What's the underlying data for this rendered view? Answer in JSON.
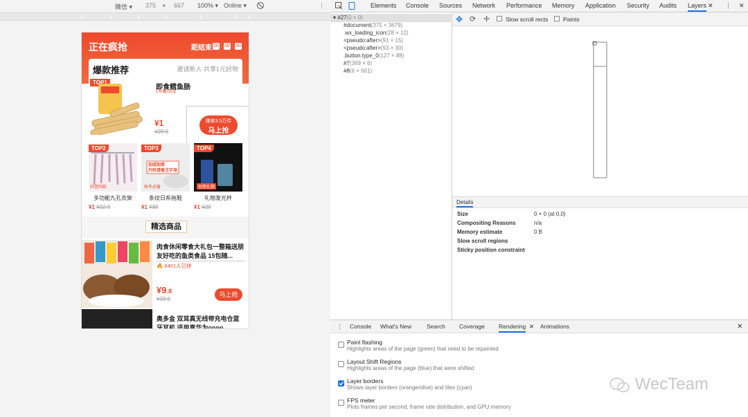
{
  "device_toolbar": {
    "device": "微信 ▾",
    "width": "375",
    "height": "667",
    "zoom": "100% ▾",
    "network": "Online ▾",
    "times": "×"
  },
  "phone": {
    "header_title": "正在疯抢",
    "countdown_label": "距结束",
    "countdown": [
      "00",
      "00",
      "00"
    ],
    "card_title": "爆款推荐",
    "card_sub": "邀请新人 共享1元好物",
    "top1": {
      "tag": "TOP1",
      "name": "即食鳕鱼肠",
      "sub": "1号罐150g",
      "price": "¥1",
      "old": "¥29.9",
      "sold": "爆卖3.5万件",
      "btn": "马上抢"
    },
    "tops": [
      {
        "tag": "TOP2",
        "name": "多功能九孔衣架",
        "price": "¥1",
        "old": "¥22.9",
        "badge": "抖音同款"
      },
      {
        "tag": "TOP3",
        "name": "条纹日系拖鞋",
        "price": "¥1",
        "old": "¥39",
        "badge": "秋冬必备",
        "img_text": "加绒加厚\n尺码请备注字母"
      },
      {
        "tag": "TOP4",
        "name": "礼物发光杯",
        "price": "¥1",
        "old": "¥29",
        "badge": "创意礼物"
      }
    ],
    "section_title": "精选商品",
    "items": [
      {
        "title": "肉食休闲零食大礼包一整箱送朋友好吃的鱼类食品 15包随...",
        "group": "🔥 6401人已拼",
        "price_main": "¥9",
        "price_dec": ".8",
        "old": "¥29.9",
        "btn": "马上抢"
      },
      {
        "title": "奥多金 双耳真无线带充电仓蓝牙耳机 适用真华为oppo..."
      }
    ]
  },
  "devtools": {
    "tabs": [
      "Elements",
      "Console",
      "Sources",
      "Network",
      "Performance",
      "Memory",
      "Application",
      "Security",
      "Audits",
      "Layers"
    ],
    "active_tab": "Layers",
    "tree": [
      {
        "name": "▾ #27",
        "meta": "(0 × 0)"
      },
      {
        "name": "#document",
        "meta": "(375 × 3679)"
      },
      {
        "name": ".wx_loading_icon",
        "meta": "(28 × 12)"
      },
      {
        "name": "<pseudo:after>",
        "meta": "(91 × 15)"
      },
      {
        "name": "<pseudo:after>",
        "meta": "(93 × 30)"
      },
      {
        "name": ".button.type_0",
        "meta": "(127 × 88)"
      },
      {
        "name": "#7",
        "meta": "(369 × 6)"
      },
      {
        "name": "#8",
        "meta": "(6 × 661)"
      }
    ],
    "layer_toolbar": {
      "slow_scroll": "Slow scroll rects",
      "paints": "Paints"
    },
    "details_tab": "Details",
    "details": [
      {
        "k": "Size",
        "v": "0 × 0 (at 0,0)"
      },
      {
        "k": "Compositing Reasons",
        "v": "n/a"
      },
      {
        "k": "Memory estimate",
        "v": "0 B"
      },
      {
        "k": "Slow scroll regions",
        "v": ""
      },
      {
        "k": "Sticky position constraint",
        "v": ""
      }
    ],
    "drawer_tabs": [
      "Console",
      "What's New",
      "Search",
      "Coverage",
      "Rendering",
      "Animations"
    ],
    "drawer_active": "Rendering",
    "rendering": [
      {
        "title": "Paint flashing",
        "desc": "Highlights areas of the page (green) that need to be repainted",
        "checked": false
      },
      {
        "title": "Layout Shift Regions",
        "desc": "Highlights areas of the page (blue) that were shifted",
        "checked": false
      },
      {
        "title": "Layer borders",
        "desc": "Shows layer borders (orange/olive) and tiles (cyan)",
        "checked": true
      },
      {
        "title": "FPS meter",
        "desc": "Plots frames per second, frame rate distribution, and GPU memory",
        "checked": false
      }
    ]
  },
  "watermark": "WecTeam",
  "colors": {
    "accent": "#ee4a2d",
    "devtools_blue": "#1a73e8"
  }
}
